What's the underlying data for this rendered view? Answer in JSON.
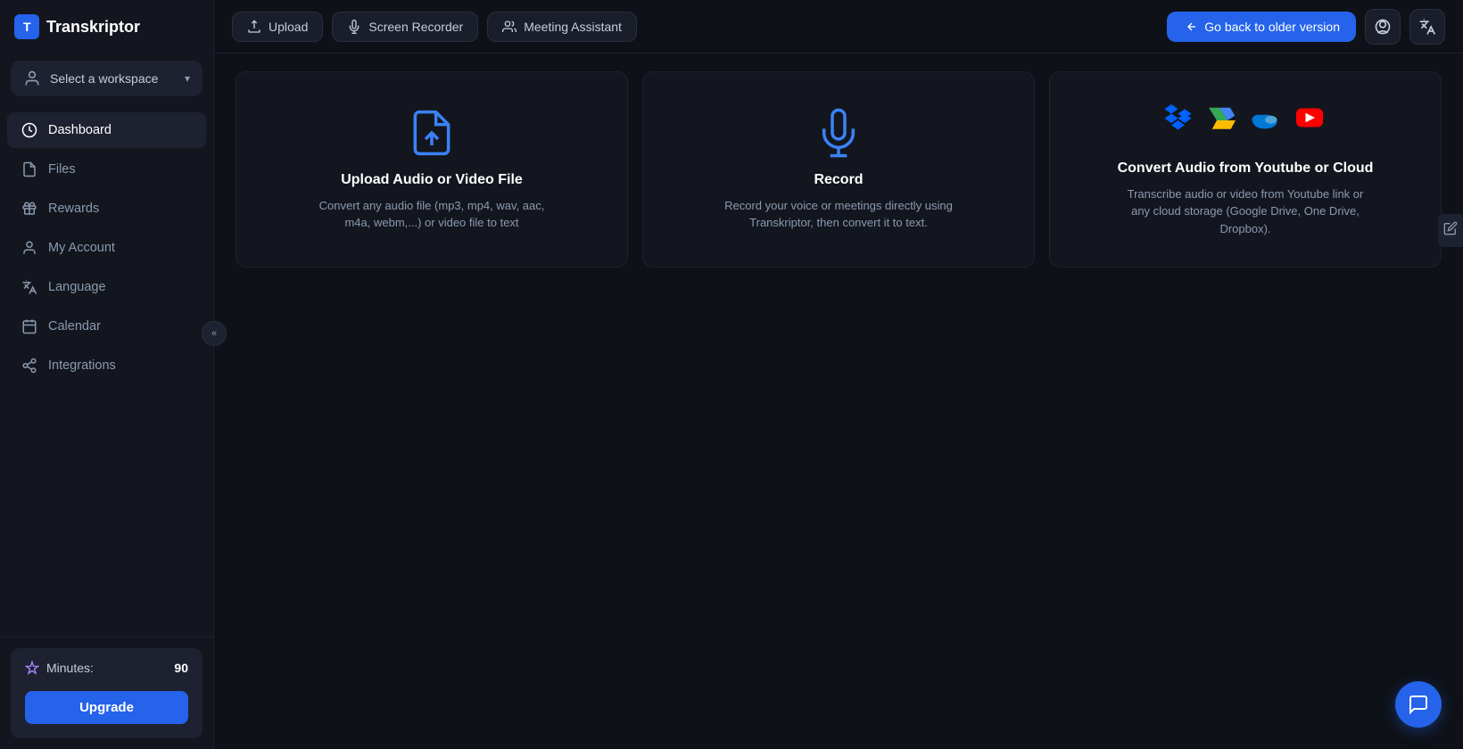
{
  "app": {
    "name": "Transkriptor",
    "logo_letter": "T"
  },
  "sidebar": {
    "workspace": {
      "label": "Select a workspace",
      "chevron": "▾"
    },
    "nav_items": [
      {
        "id": "dashboard",
        "label": "Dashboard",
        "icon": "dashboard",
        "active": true
      },
      {
        "id": "files",
        "label": "Files",
        "icon": "files"
      },
      {
        "id": "rewards",
        "label": "Rewards",
        "icon": "rewards"
      },
      {
        "id": "my-account",
        "label": "My Account",
        "icon": "account"
      },
      {
        "id": "language",
        "label": "Language",
        "icon": "language"
      },
      {
        "id": "calendar",
        "label": "Calendar",
        "icon": "calendar"
      },
      {
        "id": "integrations",
        "label": "Integrations",
        "icon": "integrations"
      }
    ],
    "minutes": {
      "label": "Minutes:",
      "value": "90"
    },
    "upgrade_btn": "Upgrade"
  },
  "topbar": {
    "buttons": [
      {
        "id": "upload",
        "label": "Upload",
        "icon": "upload"
      },
      {
        "id": "screen-recorder",
        "label": "Screen Recorder",
        "icon": "screen"
      },
      {
        "id": "meeting-assistant",
        "label": "Meeting Assistant",
        "icon": "meeting"
      }
    ],
    "go_back_btn": "Go back to older version"
  },
  "cards": [
    {
      "id": "upload-card",
      "title": "Upload Audio or Video File",
      "description": "Convert any audio file (mp3, mp4, wav, aac, m4a, webm,...) or video file to text",
      "icon_type": "file-upload"
    },
    {
      "id": "record-card",
      "title": "Record",
      "description": "Record your voice or meetings directly using Transkriptor, then convert it to text.",
      "icon_type": "microphone"
    },
    {
      "id": "cloud-card",
      "title": "Convert Audio from Youtube or Cloud",
      "description": "Transcribe audio or video from Youtube link or any cloud storage (Google Drive, One Drive, Dropbox).",
      "icon_type": "cloud"
    }
  ]
}
